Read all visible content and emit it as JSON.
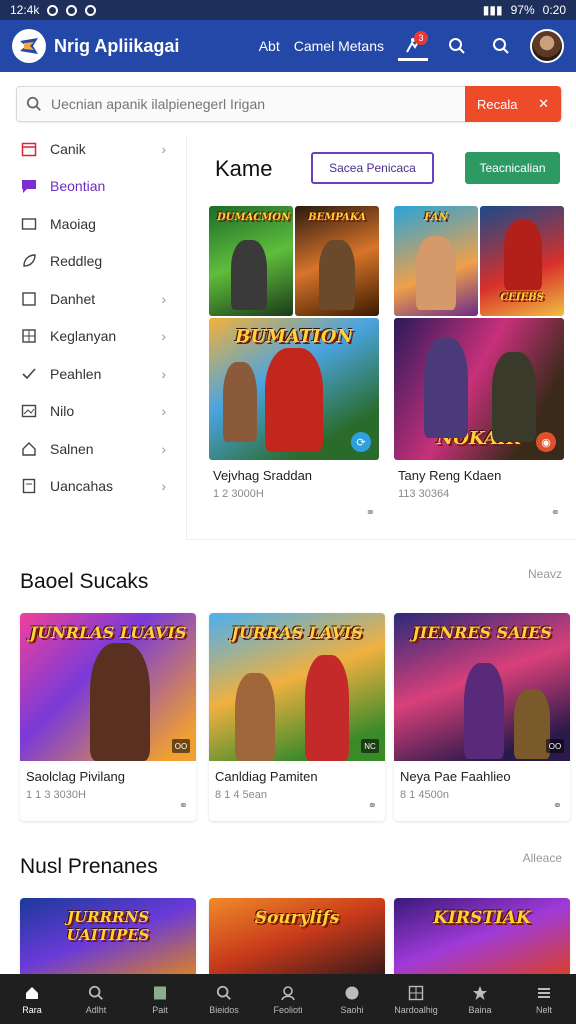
{
  "status": {
    "time": "12:4k",
    "right": "97%",
    "clock": "0:20"
  },
  "app": {
    "title": "Nrig Apliikagai",
    "nav_1": "Abt",
    "nav_2": "Camel Metans",
    "notif_count": "3",
    "accent": "#2448a8"
  },
  "search": {
    "placeholder": "Uecnian apanik ilalpienegerl Irigan",
    "button": "Recala"
  },
  "sidebar": {
    "items": [
      {
        "label": "Canik",
        "icon": "calendar-icon"
      },
      {
        "label": "Beontian",
        "icon": "chat-icon",
        "active": true
      },
      {
        "label": "Maoiag",
        "icon": "folder-icon"
      },
      {
        "label": "Reddleg",
        "icon": "leaf-icon"
      },
      {
        "label": "Danhet",
        "icon": "square-icon"
      },
      {
        "label": "Keglanyan",
        "icon": "grid-icon"
      },
      {
        "label": "Peahlen",
        "icon": "check-icon"
      },
      {
        "label": "Nilo",
        "icon": "image-icon"
      },
      {
        "label": "Salnen",
        "icon": "home-icon"
      },
      {
        "label": "Uancahas",
        "icon": "doc-icon"
      }
    ]
  },
  "panel": {
    "title": "Kame",
    "outline_button": "Sacea Penicaca",
    "green_button": "Teacnicalian",
    "cards": [
      {
        "thumb_left": "DUMACMON",
        "thumb_right": "BEMPAKA",
        "big_title": "BUMATION",
        "name": "Vejvhag Sraddan",
        "meta": "1 2 3000H"
      },
      {
        "thumb_left": "FAN",
        "thumb_right": "CEIEBS",
        "big_title": "NOKAIR",
        "name": "Tany Reng Kdaen",
        "meta": "113 30364"
      }
    ]
  },
  "section1": {
    "title": "Baoel Sucaks",
    "link": "Neavz",
    "cards": [
      {
        "art_title": "JUNRLAS LUAVIS",
        "name": "Saolclag Pivilang",
        "meta": "1 1 3 3030H",
        "tag": "OO"
      },
      {
        "art_title": "JURRAS LAVIS",
        "name": "Canldiag Pamiten",
        "meta": "8 1 4 5ean",
        "tag": "NC"
      },
      {
        "art_title": "JIENRES SAIES",
        "name": "Neya Pae Faahlieo",
        "meta": "8 1 4500n",
        "tag": "OO"
      }
    ]
  },
  "section2": {
    "title": "Nusl Prenanes",
    "link": "Alleace",
    "cards": [
      {
        "art_title": "JURRRNS UAITIPES"
      },
      {
        "art_title": "Sourylifs"
      },
      {
        "art_title": "KIRSTIAK"
      }
    ]
  },
  "tabs": [
    {
      "label": "Rara",
      "icon": "home-icon"
    },
    {
      "label": "Adlht",
      "icon": "search-icon"
    },
    {
      "label": "Pait",
      "icon": "note-icon"
    },
    {
      "label": "Bieidos",
      "icon": "search-icon"
    },
    {
      "label": "Feolioti",
      "icon": "person-icon"
    },
    {
      "label": "Saohi",
      "icon": "shield-icon"
    },
    {
      "label": "Nardoalhig",
      "icon": "grid-icon"
    },
    {
      "label": "Baina",
      "icon": "star-icon"
    },
    {
      "label": "Nelt",
      "icon": "menu-icon"
    }
  ]
}
